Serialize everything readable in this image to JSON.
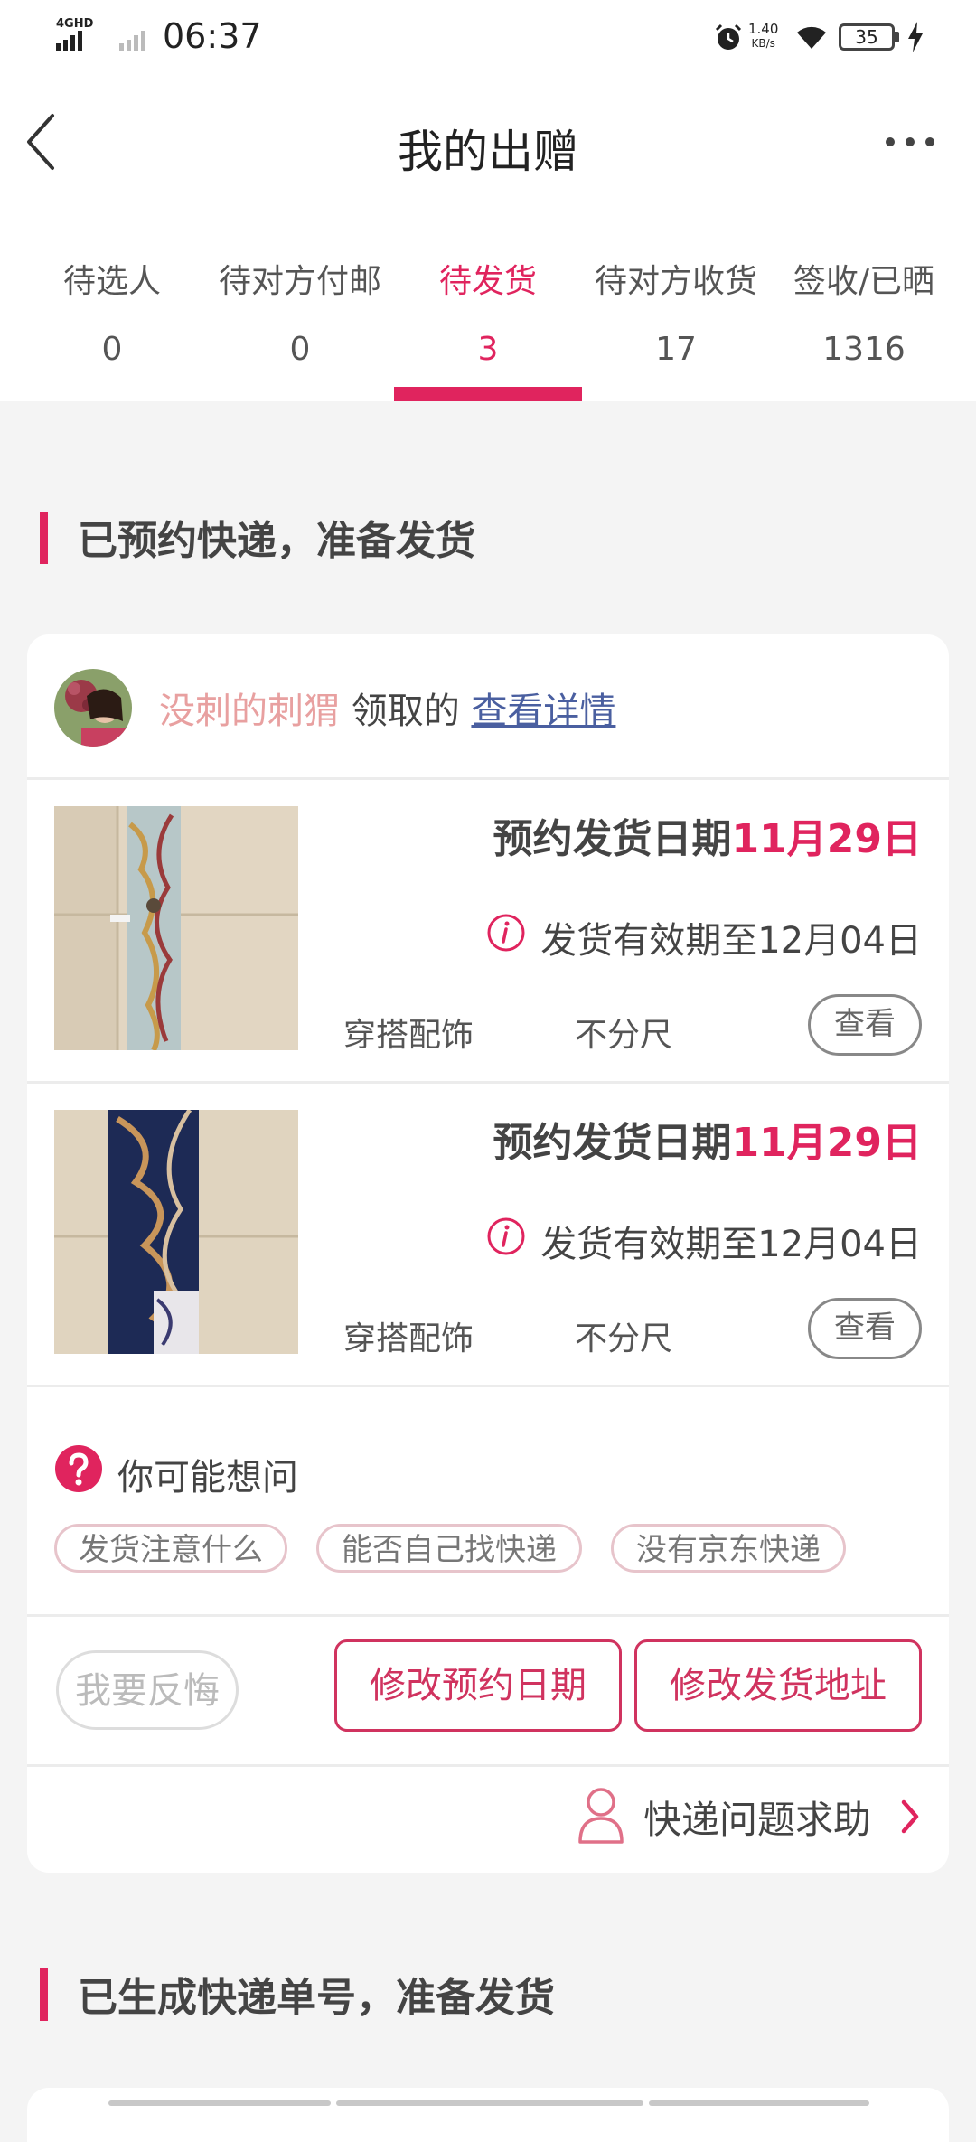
{
  "status_bar": {
    "network": "4GHD",
    "time": "06:37",
    "speed_value": "1.40",
    "speed_unit": "KB/s",
    "battery": "35"
  },
  "header": {
    "title": "我的出赠"
  },
  "tabs": [
    {
      "label": "待选人",
      "count": "0"
    },
    {
      "label": "待对方付邮",
      "count": "0"
    },
    {
      "label": "待发货",
      "count": "3"
    },
    {
      "label": "待对方收货",
      "count": "17"
    },
    {
      "label": "签收/已晒",
      "count": "1316"
    }
  ],
  "active_tab": "待发货",
  "section1": {
    "title": "已预约快递，准备发货"
  },
  "card": {
    "receiver_name": "没刺的刺猬",
    "receiver_suffix": "领取的",
    "detail_link": "查看详情",
    "items": [
      {
        "date_label": "预约发货日期",
        "date_value": "11月29日",
        "deadline": "发货有效期至12月04日",
        "category": "穿搭配饰",
        "size": "不分尺",
        "view_label": "查看"
      },
      {
        "date_label": "预约发货日期",
        "date_value": "11月29日",
        "deadline": "发货有效期至12月04日",
        "category": "穿搭配饰",
        "size": "不分尺",
        "view_label": "查看"
      }
    ],
    "faq": {
      "title": "你可能想问",
      "chips": [
        "发货注意什么",
        "能否自己找快递",
        "没有京东快递"
      ]
    },
    "actions": {
      "regret": "我要反悔",
      "change_date": "修改预约日期",
      "change_address": "修改发货地址"
    },
    "help": {
      "label": "快递问题求助"
    }
  },
  "section2": {
    "title": "已生成快递单号，准备发货"
  },
  "colors": {
    "accent": "#e0245e",
    "name": "#e8a0a0",
    "link": "#4a5fa0",
    "background": "#f4f4f4"
  }
}
